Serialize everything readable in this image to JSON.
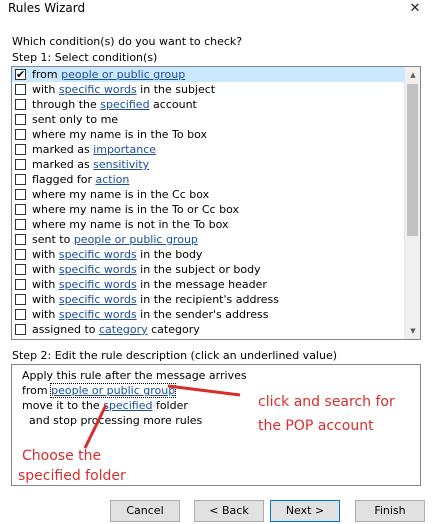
{
  "window": {
    "title": "Rules Wizard",
    "close_glyph": "✕"
  },
  "question": "Which condition(s) do you want to check?",
  "step1_label": "Step 1: Select condition(s)",
  "conditions": [
    {
      "checked": true,
      "selected": true,
      "pre": "from ",
      "link": "people or public group",
      "post": ""
    },
    {
      "checked": false,
      "pre": "with ",
      "link": "specific words",
      "post": " in the subject"
    },
    {
      "checked": false,
      "pre": "through the ",
      "link": "specified",
      "post": " account"
    },
    {
      "checked": false,
      "pre": "sent only to me",
      "link": "",
      "post": ""
    },
    {
      "checked": false,
      "pre": "where my name is in the To box",
      "link": "",
      "post": ""
    },
    {
      "checked": false,
      "pre": "marked as ",
      "link": "importance",
      "post": ""
    },
    {
      "checked": false,
      "pre": "marked as ",
      "link": "sensitivity",
      "post": ""
    },
    {
      "checked": false,
      "pre": "flagged for ",
      "link": "action",
      "post": ""
    },
    {
      "checked": false,
      "pre": "where my name is in the Cc box",
      "link": "",
      "post": ""
    },
    {
      "checked": false,
      "pre": "where my name is in the To or Cc box",
      "link": "",
      "post": ""
    },
    {
      "checked": false,
      "pre": "where my name is not in the To box",
      "link": "",
      "post": ""
    },
    {
      "checked": false,
      "pre": "sent to ",
      "link": "people or public group",
      "post": ""
    },
    {
      "checked": false,
      "pre": "with ",
      "link": "specific words",
      "post": " in the body"
    },
    {
      "checked": false,
      "pre": "with ",
      "link": "specific words",
      "post": " in the subject or body"
    },
    {
      "checked": false,
      "pre": "with ",
      "link": "specific words",
      "post": " in the message header"
    },
    {
      "checked": false,
      "pre": "with ",
      "link": "specific words",
      "post": " in the recipient's address"
    },
    {
      "checked": false,
      "pre": "with ",
      "link": "specific words",
      "post": " in the sender's address"
    },
    {
      "checked": false,
      "pre": "assigned to ",
      "link": "category",
      "post": " category"
    }
  ],
  "step2_label": "Step 2: Edit the rule description (click an underlined value)",
  "description": {
    "line1": "Apply this rule after the message arrives",
    "line2_pre": "from ",
    "line2_link": "people or public group",
    "line3_pre": "move it to the ",
    "line3_link": "specified",
    "line3_post": " folder",
    "line4": "  and stop processing more rules"
  },
  "annotations": {
    "right_line1": "click and search for",
    "right_line2": "the POP account",
    "left_line1": "Choose the",
    "left_line2": "specified folder",
    "color": "#d92d2d"
  },
  "buttons": {
    "cancel": "Cancel",
    "back": "< Back",
    "next": "Next >",
    "finish": "Finish"
  }
}
